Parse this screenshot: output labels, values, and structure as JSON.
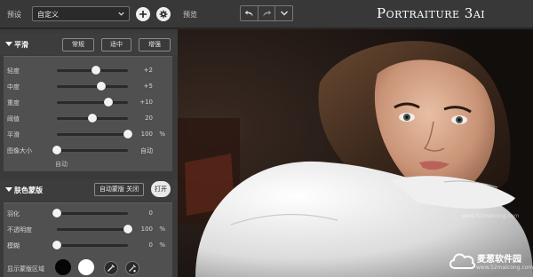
{
  "topbar": {
    "preset_label": "预设",
    "preset_value": "自定义",
    "preview_label": "预览",
    "logo": "Portraiture 3ai"
  },
  "smooth": {
    "title": "平滑",
    "chips": [
      "常规",
      "适中",
      "增强"
    ],
    "sliders": [
      {
        "label": "轻度",
        "value": "+2",
        "unit": "",
        "level": 0.55
      },
      {
        "label": "中度",
        "value": "+5",
        "unit": "",
        "level": 0.62
      },
      {
        "label": "重度",
        "value": "+10",
        "unit": "",
        "level": 0.72
      },
      {
        "label": "阈值",
        "value": "20",
        "unit": "",
        "level": 0.5
      },
      {
        "label": "平滑",
        "value": "100",
        "unit": "%",
        "level": 1.0
      },
      {
        "label": "图像大小",
        "value": "自动",
        "unit": "",
        "level": 0.0
      }
    ],
    "image_size_sub": "自动"
  },
  "skin_mask": {
    "title": "肤色蒙版",
    "auto_mask": "自动蒙版 关闭",
    "toggle": "打开",
    "sliders": [
      {
        "label": "羽化",
        "value": "0",
        "unit": "",
        "level": 0.0
      },
      {
        "label": "不透明度",
        "value": "100",
        "unit": "%",
        "level": 1.0
      },
      {
        "label": "模糊",
        "value": "0",
        "unit": "%",
        "level": 0.0
      }
    ],
    "show_mask_label": "显示蒙版区域"
  },
  "watermark": {
    "site_name": "麦葱软件园",
    "url": "www.52maicong.com"
  },
  "colors": {
    "panel": "#3a3a3a",
    "section_body": "#505050",
    "topbar": "#383838"
  }
}
